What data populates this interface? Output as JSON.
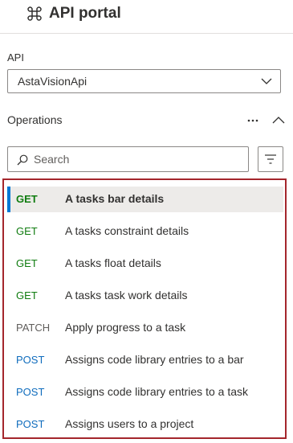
{
  "header": {
    "title": "API portal",
    "logo_icon": "command-icon"
  },
  "api_selector": {
    "label": "API",
    "value": "AstaVisionApi"
  },
  "operations": {
    "label": "Operations",
    "search_placeholder": "Search",
    "items": [
      {
        "method": "GET",
        "name": "A tasks bar details",
        "selected": true
      },
      {
        "method": "GET",
        "name": "A tasks constraint details"
      },
      {
        "method": "GET",
        "name": "A tasks float details"
      },
      {
        "method": "GET",
        "name": "A tasks task work details"
      },
      {
        "method": "PATCH",
        "name": "Apply progress to a task"
      },
      {
        "method": "POST",
        "name": "Assigns code library entries to a bar"
      },
      {
        "method": "POST",
        "name": "Assigns code library entries to a task"
      },
      {
        "method": "POST",
        "name": "Assigns users to a project"
      }
    ]
  },
  "colors": {
    "accent": "#0078d4",
    "highlight_border": "#a4262c",
    "get": "#107c10",
    "patch": "#605e5c",
    "post": "#0f6cbd"
  }
}
